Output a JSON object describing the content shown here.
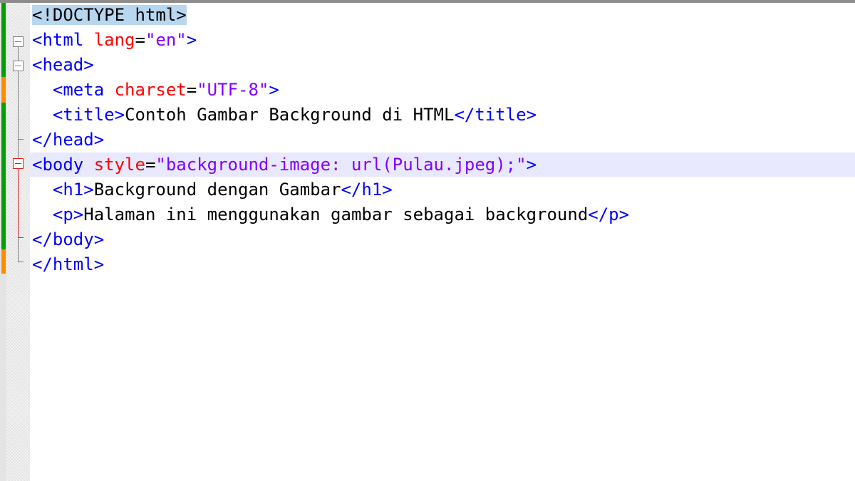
{
  "editor": {
    "colors": {
      "tag": "#0000ff",
      "attribute": "#ff0000",
      "attribute_value": "#8000ff",
      "text": "#000000",
      "current_line_bg": "#e8e8ff",
      "change_saved": "#00a000",
      "change_modified": "#ff8c00",
      "fold_marker_active": "#e02020"
    },
    "lines": [
      {
        "doctype": "<!DOCTYPE html>"
      },
      {
        "open": "<html",
        "attr": "lang",
        "eq": "=",
        "val": "\"en\"",
        "close": ">"
      },
      {
        "tag": "<head>"
      },
      {
        "indent": "  ",
        "open": "<meta",
        "attr": "charset",
        "eq": "=",
        "val": "\"UTF-8\"",
        "close": ">"
      },
      {
        "indent": "  ",
        "open": "<title>",
        "text": "Contoh Gambar Background di HTML",
        "close": "</title>"
      },
      {
        "tag": "</head>"
      },
      {
        "open": "<body",
        "attr": "style",
        "eq": "=",
        "val": "\"background-image: url(Pulau.jpeg);\"",
        "close": ">"
      },
      {
        "indent": "  ",
        "open": "<h1>",
        "text": "Background dengan Gambar",
        "close": "</h1>"
      },
      {
        "indent": "  ",
        "open": "<p>",
        "text": "Halaman ini menggunakan gambar sebagai background",
        "close": "</p>"
      },
      {
        "tag": "</body>"
      },
      {
        "tag": "</html>"
      }
    ]
  }
}
